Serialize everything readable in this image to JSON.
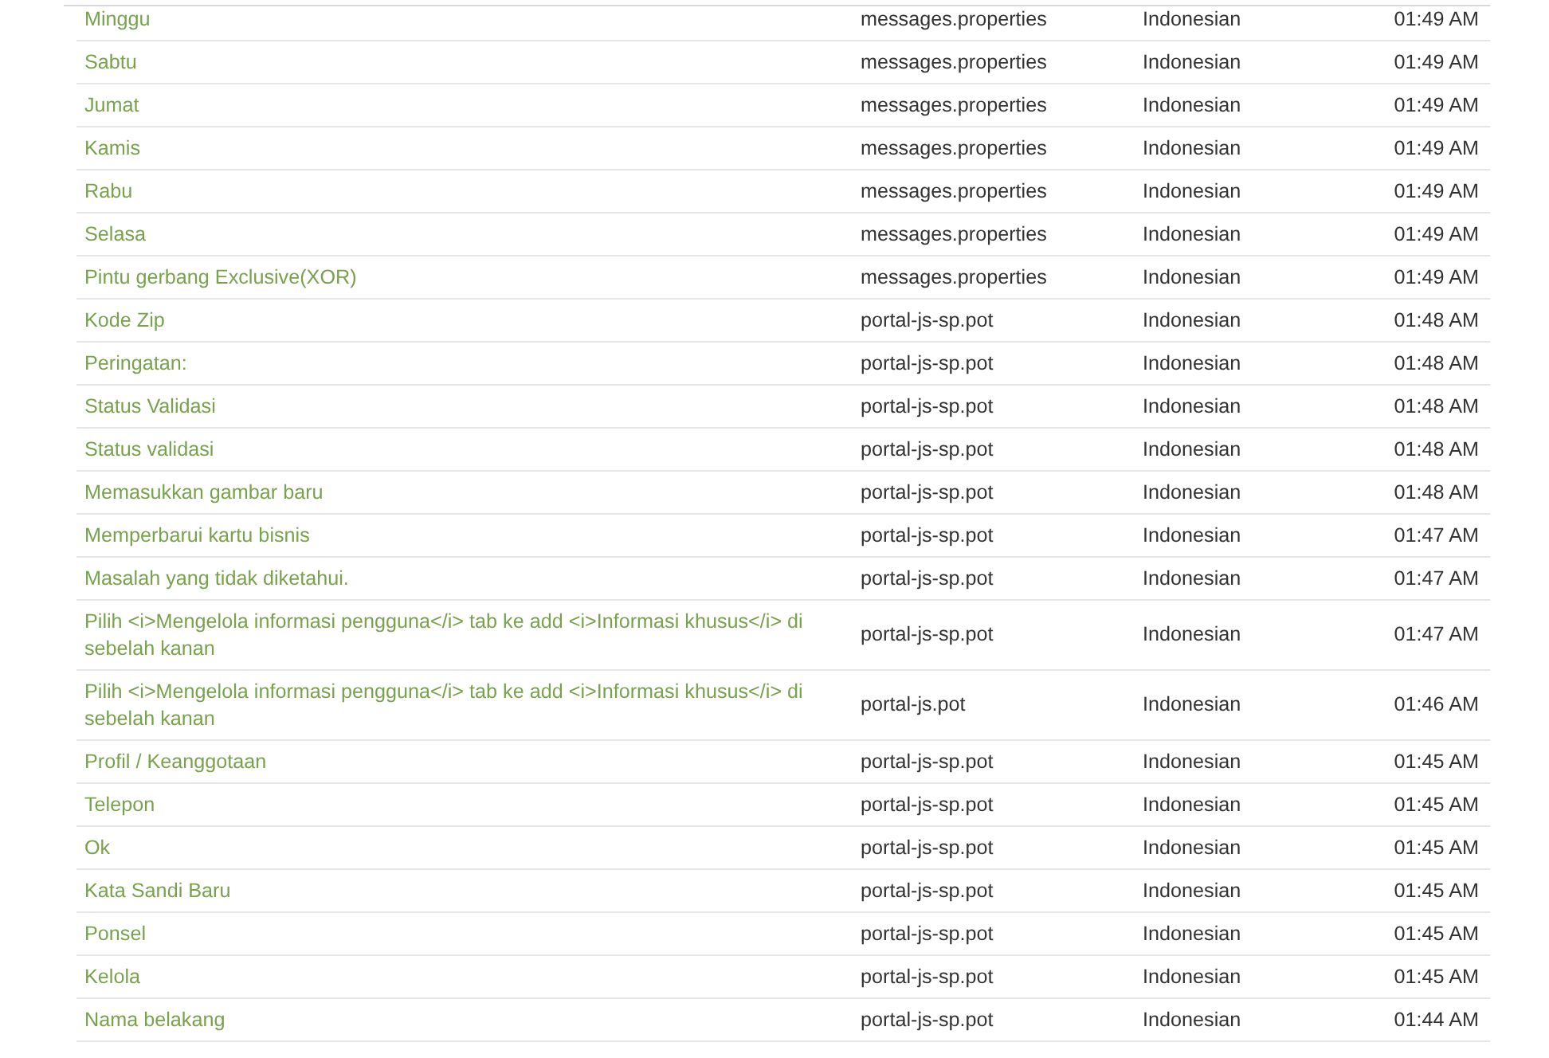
{
  "table": {
    "rows": [
      {
        "text": "Minggu",
        "file": "messages.properties",
        "language": "Indonesian",
        "time": "01:49 AM"
      },
      {
        "text": "Sabtu",
        "file": "messages.properties",
        "language": "Indonesian",
        "time": "01:49 AM"
      },
      {
        "text": "Jumat",
        "file": "messages.properties",
        "language": "Indonesian",
        "time": "01:49 AM"
      },
      {
        "text": "Kamis",
        "file": "messages.properties",
        "language": "Indonesian",
        "time": "01:49 AM"
      },
      {
        "text": "Rabu",
        "file": "messages.properties",
        "language": "Indonesian",
        "time": "01:49 AM"
      },
      {
        "text": "Selasa",
        "file": "messages.properties",
        "language": "Indonesian",
        "time": "01:49 AM"
      },
      {
        "text": "Pintu gerbang Exclusive(XOR)",
        "file": "messages.properties",
        "language": "Indonesian",
        "time": "01:49 AM"
      },
      {
        "text": "Kode Zip",
        "file": "portal-js-sp.pot",
        "language": "Indonesian",
        "time": "01:48 AM"
      },
      {
        "text": "Peringatan:",
        "file": "portal-js-sp.pot",
        "language": "Indonesian",
        "time": "01:48 AM"
      },
      {
        "text": "Status Validasi",
        "file": "portal-js-sp.pot",
        "language": "Indonesian",
        "time": "01:48 AM"
      },
      {
        "text": "Status validasi",
        "file": "portal-js-sp.pot",
        "language": "Indonesian",
        "time": "01:48 AM"
      },
      {
        "text": "Memasukkan gambar baru",
        "file": "portal-js-sp.pot",
        "language": "Indonesian",
        "time": "01:48 AM"
      },
      {
        "text": "Memperbarui kartu bisnis",
        "file": "portal-js-sp.pot",
        "language": "Indonesian",
        "time": "01:47 AM"
      },
      {
        "text": "Masalah yang tidak diketahui.",
        "file": "portal-js-sp.pot",
        "language": "Indonesian",
        "time": "01:47 AM"
      },
      {
        "text": "Pilih <i>Mengelola informasi pengguna</i> tab ke add <i>Informasi khusus</i> di sebelah kanan",
        "file": "portal-js-sp.pot",
        "language": "Indonesian",
        "time": "01:47 AM"
      },
      {
        "text": "Pilih <i>Mengelola informasi pengguna</i> tab ke add <i>Informasi khusus</i> di sebelah kanan",
        "file": "portal-js.pot",
        "language": "Indonesian",
        "time": "01:46 AM"
      },
      {
        "text": "Profil / Keanggotaan",
        "file": "portal-js-sp.pot",
        "language": "Indonesian",
        "time": "01:45 AM"
      },
      {
        "text": "Telepon",
        "file": "portal-js-sp.pot",
        "language": "Indonesian",
        "time": "01:45 AM"
      },
      {
        "text": "Ok",
        "file": "portal-js-sp.pot",
        "language": "Indonesian",
        "time": "01:45 AM"
      },
      {
        "text": "Kata Sandi Baru",
        "file": "portal-js-sp.pot",
        "language": "Indonesian",
        "time": "01:45 AM"
      },
      {
        "text": "Ponsel",
        "file": "portal-js-sp.pot",
        "language": "Indonesian",
        "time": "01:45 AM"
      },
      {
        "text": "Kelola",
        "file": "portal-js-sp.pot",
        "language": "Indonesian",
        "time": "01:45 AM"
      },
      {
        "text": "Nama belakang",
        "file": "portal-js-sp.pot",
        "language": "Indonesian",
        "time": "01:44 AM"
      }
    ]
  }
}
